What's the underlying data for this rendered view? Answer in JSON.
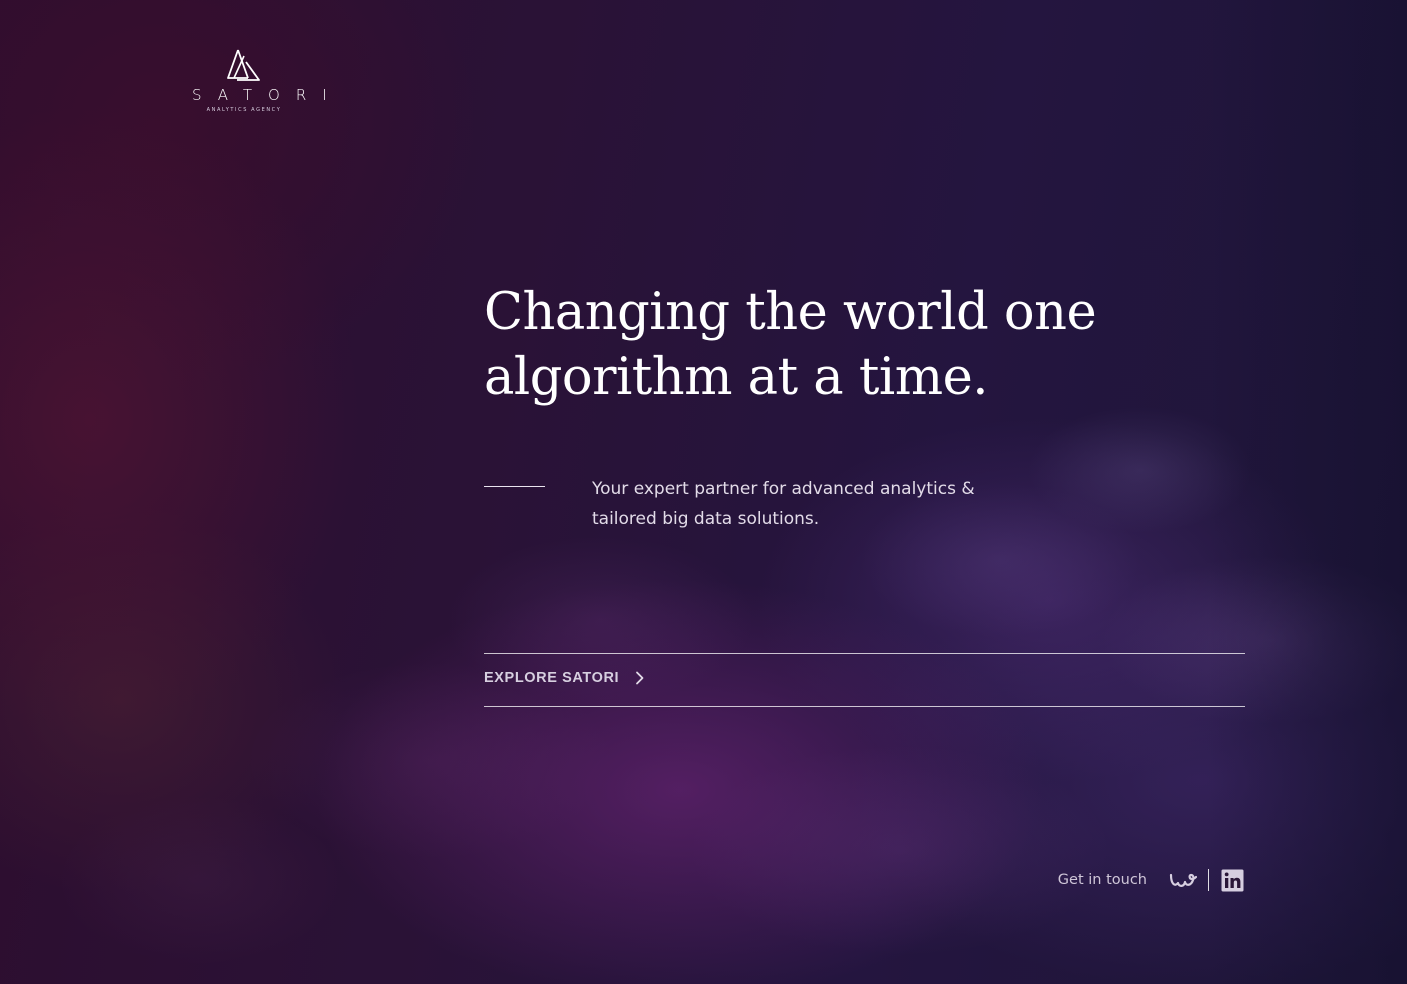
{
  "brand": {
    "name": "SATORI",
    "tagline": "ANALYTICS AGENCY",
    "logo_icon": "triangle-mountain-icon"
  },
  "hero": {
    "headline_line1": "Changing the world one",
    "headline_line2": "algorithm at a time.",
    "subtitle_line1": "Your expert partner for advanced analytics &",
    "subtitle_line2": "tailored big data solutions."
  },
  "cta": {
    "label": "EXPLORE SATORI",
    "icon": "chevron-right-icon"
  },
  "footer": {
    "contact_label": "Get in touch",
    "social": [
      {
        "name": "welcome-to-the-jungle",
        "icon": "w-brand-icon"
      },
      {
        "name": "linkedin",
        "icon": "linkedin-icon"
      }
    ]
  },
  "colors": {
    "text": "#ffffff",
    "muted_text": "#d7cfe0",
    "background_dark": "#22123a",
    "background_accent": "#5a2a6e"
  }
}
